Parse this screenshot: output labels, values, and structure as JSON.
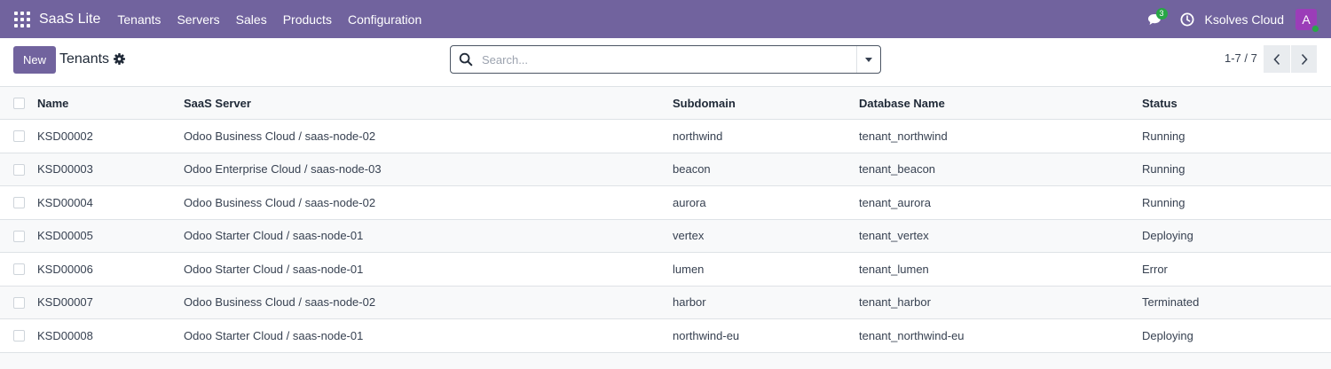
{
  "navbar": {
    "brand": "SaaS Lite",
    "menu": [
      "Tenants",
      "Servers",
      "Sales",
      "Products",
      "Configuration"
    ],
    "chat_count": "3",
    "company": "Ksolves Cloud",
    "avatar_letter": "A",
    "background_color": "#71639e",
    "icons": [
      "apps-grid-icon",
      "chat-icon",
      "clock-icon"
    ]
  },
  "control": {
    "new_label": "New",
    "title": "Tenants",
    "search_placeholder": "Search...",
    "pager": "1-7 / 7",
    "icons": [
      "gear-icon",
      "search-icon",
      "chevron-down-icon",
      "chevron-left-icon",
      "chevron-right-icon"
    ]
  },
  "table": {
    "columns": [
      "Name",
      "SaaS Server",
      "Subdomain",
      "Database Name",
      "Status"
    ],
    "rows": [
      [
        "KSD00002",
        "Odoo Business Cloud / saas-node-02",
        "northwind",
        "tenant_northwind",
        "Running"
      ],
      [
        "KSD00003",
        "Odoo Enterprise Cloud / saas-node-03",
        "beacon",
        "tenant_beacon",
        "Running"
      ],
      [
        "KSD00004",
        "Odoo Business Cloud / saas-node-02",
        "aurora",
        "tenant_aurora",
        "Running"
      ],
      [
        "KSD00005",
        "Odoo Starter Cloud / saas-node-01",
        "vertex",
        "tenant_vertex",
        "Deploying"
      ],
      [
        "KSD00006",
        "Odoo Starter Cloud / saas-node-01",
        "lumen",
        "tenant_lumen",
        "Error"
      ],
      [
        "KSD00007",
        "Odoo Business Cloud / saas-node-02",
        "harbor",
        "tenant_harbor",
        "Terminated"
      ],
      [
        "KSD00008",
        "Odoo Starter Cloud / saas-node-01",
        "northwind-eu",
        "tenant_northwind-eu",
        "Deploying"
      ]
    ]
  }
}
